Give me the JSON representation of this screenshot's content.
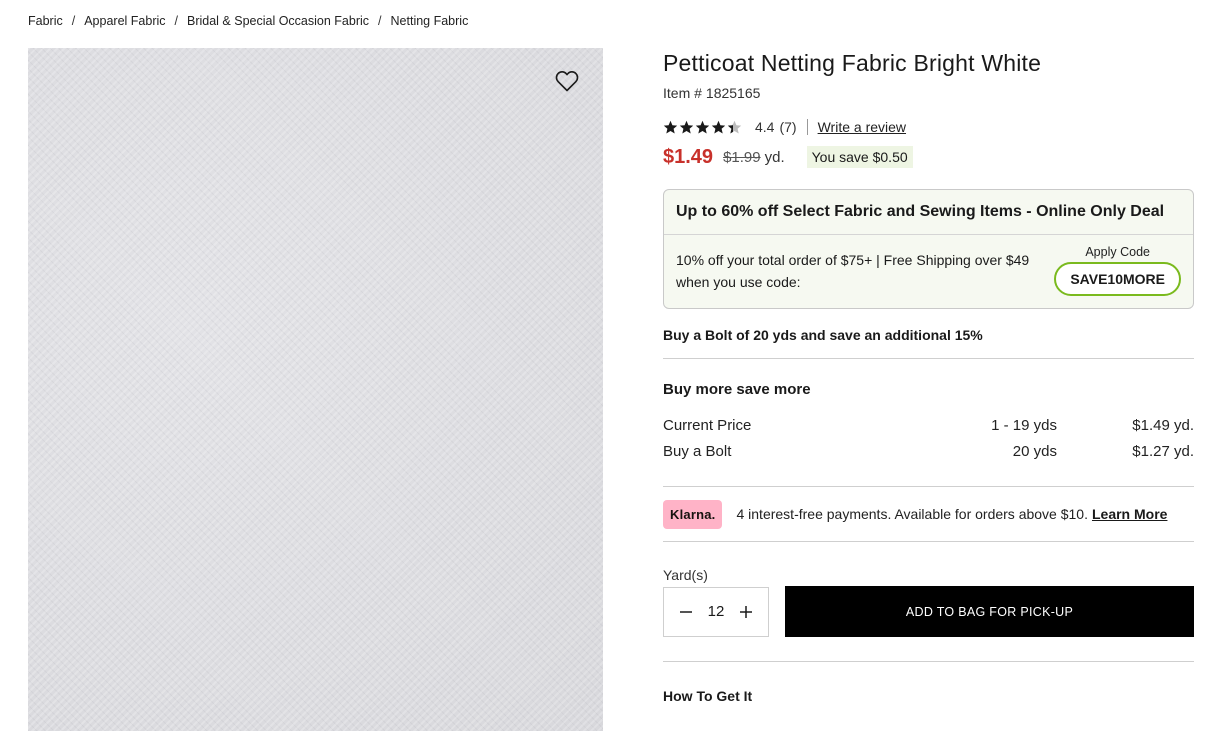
{
  "breadcrumb": [
    {
      "label": "Fabric"
    },
    {
      "label": "Apparel Fabric"
    },
    {
      "label": "Bridal & Special Occasion Fabric"
    },
    {
      "label": "Netting Fabric"
    }
  ],
  "product": {
    "title": "Petticoat Netting Fabric Bright White",
    "item_prefix": "Item #",
    "item_number": "1825165",
    "rating": 4.4,
    "rating_text": "4.4",
    "review_count": "(7)",
    "write_review": "Write a review",
    "sale_price": "$1.49",
    "original_price": "$1.99",
    "unit": "yd.",
    "you_save": "You save $0.50"
  },
  "promo": {
    "headline": "Up to 60% off Select Fabric and Sewing Items - Online Only Deal",
    "body": "10% off your total order of $75+ | Free Shipping over $49 when you use code:",
    "apply_label": "Apply Code",
    "code": "SAVE10MORE"
  },
  "bolt_promo": "Buy a Bolt of 20 yds and save an additional 15%",
  "tiers": {
    "title": "Buy more save more",
    "rows": [
      {
        "label": "Current Price",
        "qty": "1 - 19 yds",
        "price": "$1.49 yd."
      },
      {
        "label": "Buy a Bolt",
        "qty": "20 yds",
        "price": "$1.27 yd."
      }
    ]
  },
  "klarna": {
    "badge": "Klarna.",
    "text": "4 interest-free payments. Available for orders above $10.",
    "link": "Learn More"
  },
  "purchase": {
    "qty_label": "Yard(s)",
    "qty_value": "12",
    "add_button": "ADD TO BAG FOR PICK-UP"
  },
  "how_to": "How To Get It",
  "icons": {
    "wishlist": "heart-icon",
    "star": "star-icon",
    "minus": "minus-icon",
    "plus": "plus-icon"
  },
  "colors": {
    "sale": "#c8312b",
    "save_badge_bg": "#eef5e3",
    "code_border": "#7aba1e",
    "klarna_pink": "#ffb3c7",
    "button_bg": "#000000"
  }
}
